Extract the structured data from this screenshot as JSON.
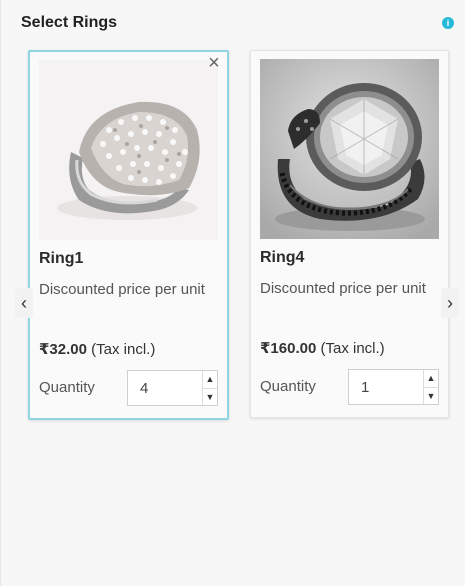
{
  "header": {
    "title": "Select Rings",
    "info_icon": "info-icon"
  },
  "nav": {
    "prev": "‹",
    "next": "›"
  },
  "cards": [
    {
      "name": "Ring1",
      "description": "Discounted price per unit",
      "price": "₹32.00",
      "tax": "(Tax incl.)",
      "quantity_label": "Quantity",
      "quantity": "4",
      "selected": true,
      "remove": "×"
    },
    {
      "name": "Ring4",
      "description": "Discounted price per unit",
      "price": "₹160.00",
      "tax": "(Tax incl.)",
      "quantity_label": "Quantity",
      "quantity": "1",
      "selected": false
    }
  ],
  "colors": {
    "accent": "#25b9d7",
    "selected_border": "#8fd6e2"
  }
}
